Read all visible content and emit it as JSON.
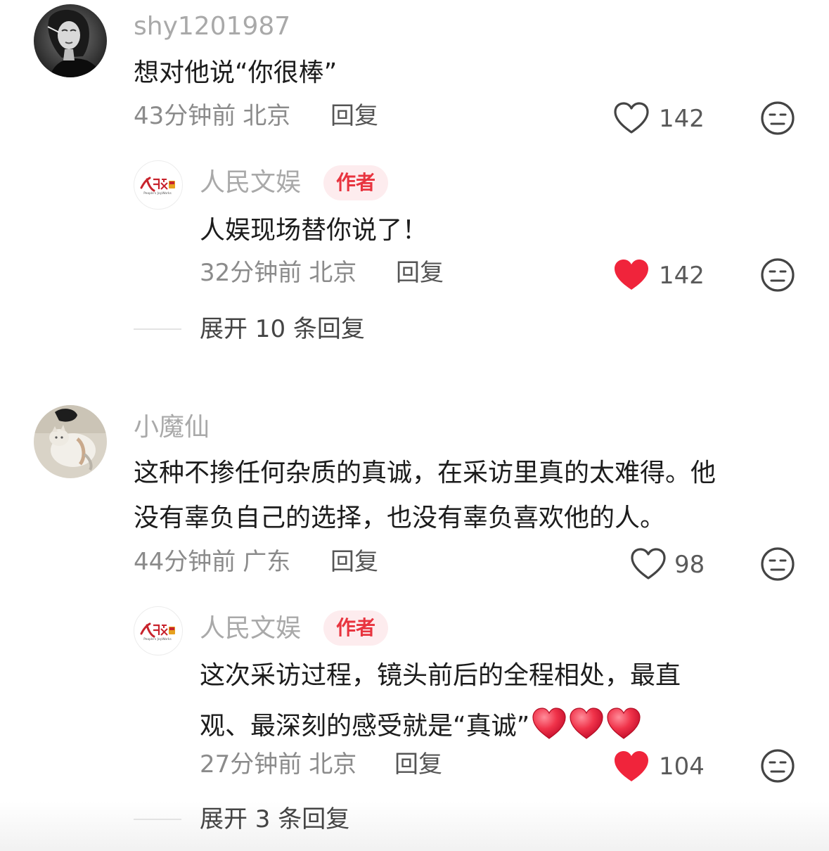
{
  "comments": [
    {
      "username": "shy1201987",
      "text": "想对他说“你很棒”",
      "time": "43分钟前",
      "location": "北京",
      "reply_label": "回复",
      "likes": "142",
      "liked": false,
      "reply": {
        "username": "人民文娱",
        "badge": "作者",
        "text": "人娱现场替你说了！",
        "time": "32分钟前",
        "location": "北京",
        "reply_label": "回复",
        "likes": "142",
        "liked": true
      },
      "expand_label": "展开 10 条回复"
    },
    {
      "username": "小魔仙",
      "text_line1": "这种不掺任何杂质的真诚，在采访里真的太难得。他",
      "text_line2": "没有辜负自己的选择，也没有辜负喜欢他的人。",
      "time": "44分钟前",
      "location": "广东",
      "reply_label": "回复",
      "likes": "98",
      "liked": false,
      "reply": {
        "username": "人民文娱",
        "badge": "作者",
        "text_line1": "这次采访过程，镜头前后的全程相处，最直",
        "text_line2": "观、最深刻的感受就是“真诚”",
        "time": "27分钟前",
        "location": "北京",
        "reply_label": "回复",
        "likes": "104",
        "liked": true
      },
      "expand_label": "展开 3 条回复"
    }
  ],
  "logo_text": {
    "main": "人民文娱",
    "sub": "People's JoyWorks"
  },
  "colors": {
    "heart_liked": "#f0243b",
    "badge_bg": "#fdecee",
    "badge_text": "#e8343f",
    "logo_red": "#c8232c"
  }
}
